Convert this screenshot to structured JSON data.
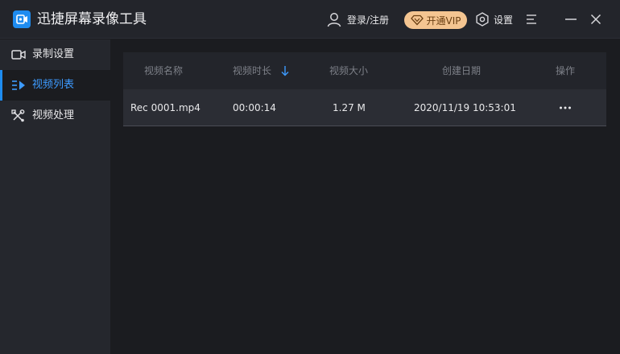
{
  "app": {
    "title": "迅捷屏幕录像工具"
  },
  "header": {
    "login_label": "登录/注册",
    "vip_label": "开通VIP",
    "settings_label": "设置"
  },
  "colors": {
    "accent": "#1e8cf0",
    "vip_bg": "#f4c591",
    "vip_text": "#6a3f12"
  },
  "sidebar": {
    "items": [
      {
        "label": "录制设置",
        "icon": "camera-icon",
        "active": false
      },
      {
        "label": "视频列表",
        "icon": "video-list-icon",
        "active": true
      },
      {
        "label": "视频处理",
        "icon": "tools-icon",
        "active": false
      }
    ]
  },
  "table": {
    "columns": [
      "视频名称",
      "视频时长",
      "视频大小",
      "创建日期",
      "操作"
    ],
    "sort_column": "视频时长",
    "sort_direction": "descending",
    "rows": [
      {
        "name": "Rec 0001.mp4",
        "duration": "00:00:14",
        "size": "1.27 M",
        "created": "2020/11/19 10:53:01"
      }
    ]
  }
}
